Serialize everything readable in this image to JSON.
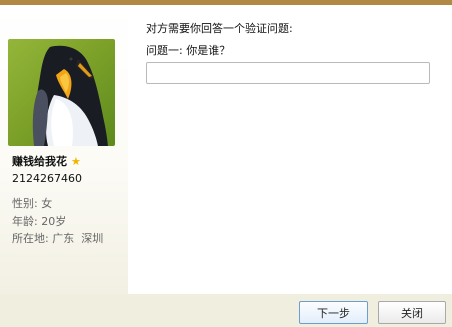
{
  "dialog": {
    "prompt": "对方需要你回答一个验证问题:",
    "question_label": "问题一: 你是谁？",
    "answer_value": "",
    "answer_placeholder": ""
  },
  "profile": {
    "avatar": "penguin-photo",
    "nickname": "赚钱给我花",
    "star_icon": "★",
    "qq_number": "2124267460",
    "gender": "性别: 女",
    "age": "年龄: 20岁",
    "location": "所在地: 广东  深圳"
  },
  "buttons": {
    "next_label": "下一步",
    "close_label": "关闭"
  },
  "colors": {
    "top_bar": "#b08a45",
    "star": "#f0b400",
    "bottom_bar": "#efeedf",
    "next_border": "#6f9dcc"
  }
}
